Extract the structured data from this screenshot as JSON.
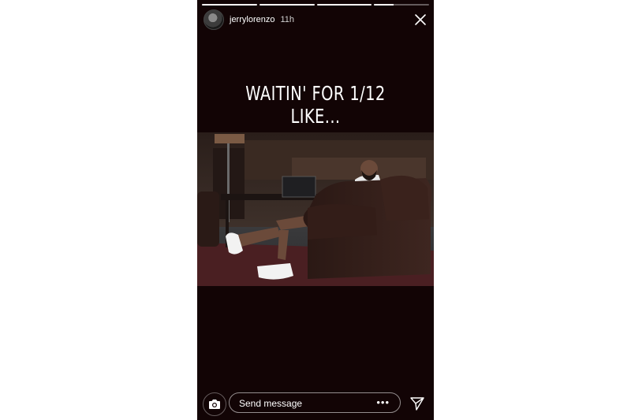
{
  "story": {
    "progress_segments": [
      1,
      1,
      1,
      0.35
    ],
    "user": {
      "username": "jerrylorenzo",
      "time_ago": "11h"
    },
    "caption": "WAITIN' FOR 1/12 LIKE...",
    "icons": {
      "close": "close-icon",
      "camera": "camera-icon",
      "more": "more-dots-icon",
      "send": "paper-plane-icon"
    }
  },
  "reply": {
    "placeholder": "Send message",
    "more_label": "•••"
  },
  "colors": {
    "background": "#120405",
    "text": "#ffffff"
  }
}
